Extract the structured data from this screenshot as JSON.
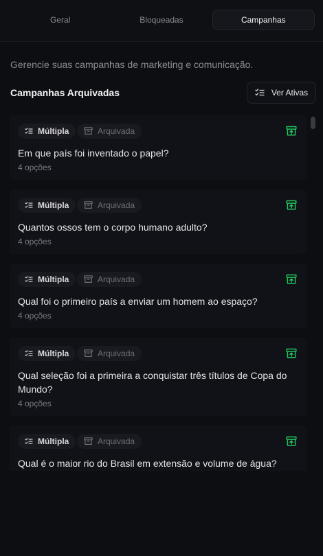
{
  "tabs": [
    {
      "label": "Geral",
      "active": false
    },
    {
      "label": "Bloqueadas",
      "active": false
    },
    {
      "label": "Campanhas",
      "active": true
    }
  ],
  "subtitle": "Gerencie suas campanhas de marketing e comunicação.",
  "section": {
    "title": "Campanhas Arquivadas",
    "toggle_button": {
      "label": "Ver Ativas",
      "icon": "list-check-icon"
    }
  },
  "badges": {
    "type_label": "Múltipla",
    "type_icon": "list-check-icon",
    "status_label": "Arquivada",
    "status_icon": "archive-icon"
  },
  "action_icon": "unarchive-icon",
  "colors": {
    "background": "#0d0e12",
    "card": "#111217",
    "accent_green": "#22c55e"
  },
  "campaigns": [
    {
      "question": "Em que país foi inventado o papel?",
      "options": "4 opções"
    },
    {
      "question": "Quantos ossos tem o corpo humano adulto?",
      "options": "4 opções"
    },
    {
      "question": "Qual foi o primeiro país a enviar um homem ao espaço?",
      "options": "4 opções"
    },
    {
      "question": "Qual seleção foi a primeira a conquistar três títulos de Copa do Mundo?",
      "options": "4 opções"
    },
    {
      "question": "Qual é o maior rio do Brasil em extensão e volume de água?",
      "options": ""
    }
  ]
}
